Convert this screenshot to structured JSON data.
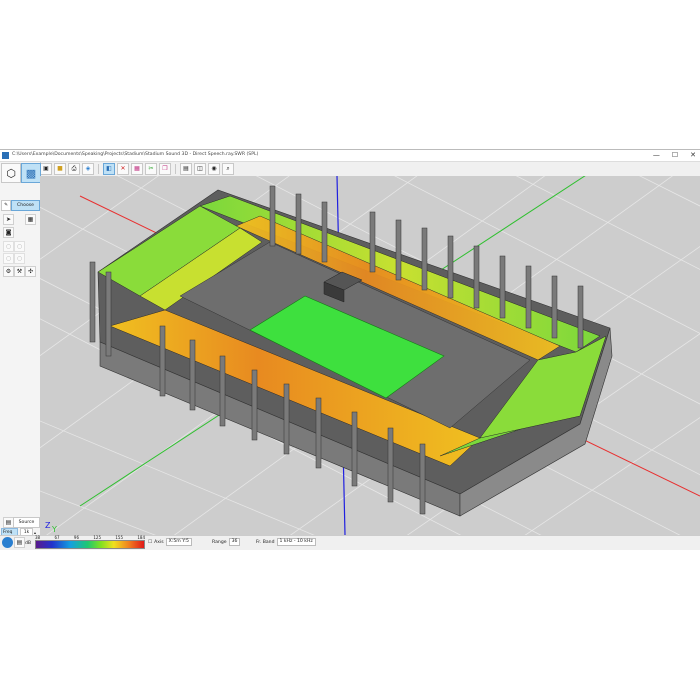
{
  "window": {
    "title": "C:\\Users\\Example\\Documents\\Speaking\\Projects\\Stadium\\Stadium Sound 3D - Direct Speech.ray.SWR (SPL)",
    "min_glyph": "—",
    "max_glyph": "☐",
    "close_glyph": "✕"
  },
  "toolbar": {
    "icons": [
      "save-icon",
      "open-icon",
      "print-icon",
      "settings-icon",
      "view3d-icon",
      "delete-icon",
      "grid-icon",
      "cut-icon",
      "copy-icon",
      "paste-icon",
      "layer-icon",
      "eye-icon",
      "zoom-icon"
    ]
  },
  "left_panel": {
    "tab_label": "Choose",
    "tools": [
      "pointer-icon",
      "table-icon",
      "speaker-icon",
      "delete-icon",
      "gear-icon",
      "settings-icon",
      "arrows-icon"
    ],
    "bottom_tab_label": "Source",
    "fields": [
      {
        "label": "Freq",
        "value": "1k"
      },
      {
        "label": "SPL",
        "value": "1"
      }
    ]
  },
  "status_bar": {
    "scale_ticks": [
      "38",
      "67",
      "96",
      "125",
      "155",
      "184"
    ],
    "scale_unit": "dB",
    "axis_label": "Axis",
    "axis_value": "X:5m   Y:5",
    "range_label": "Range",
    "range_value": "36",
    "freq_label": "Fr. Band",
    "freq_value": "1 kHz - 10 kHz"
  },
  "colors": {
    "grid_bg": "#cdcdcd",
    "structure": "#6e6e6e",
    "field": "#3ee03e",
    "seat_green": "#7ad83c",
    "seat_orange": "#f0a020",
    "axis_red": "#e83030",
    "axis_green": "#30c030",
    "axis_blue": "#2020e0"
  }
}
